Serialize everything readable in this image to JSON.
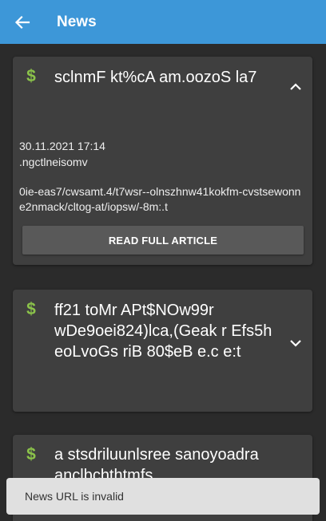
{
  "appbar": {
    "title": "News",
    "back_icon": "arrow-left-icon"
  },
  "colors": {
    "appbar": "#3d97d8",
    "background": "#2b2b2b",
    "card": "#3f3f3f",
    "dollar_icon": "#8bc34a",
    "snackbar": "#e0e0e0"
  },
  "cards": [
    {
      "icon": "dollar-icon",
      "title": "sclnmF kt%cA am.oozoS la7",
      "expanded": true,
      "date": "30.11.2021 17:14",
      "source": ".ngctlneisomv",
      "url": "0ie-eas7/cwsamt.4/t7wsr--olnszhnw41kokfm-cvstsewonne2nmack/cltog-at/iopsw/-8m:.t",
      "button_label": "READ FULL ARTICLE",
      "chevron": "chevron-up-icon"
    },
    {
      "icon": "dollar-icon",
      "title": "ff21 toMr APt$NOw99r wDe9oei824)lca,(Geak r Efs5h eoLvoGs  riB 80$eB e.c  e:t",
      "expanded": false,
      "chevron": "chevron-down-icon"
    },
    {
      "icon": "dollar-icon",
      "title": "a  stsdriluunlsree sanoyoadra anclbchthtmfs"
    }
  ],
  "snackbar": {
    "message": "News URL is invalid"
  }
}
